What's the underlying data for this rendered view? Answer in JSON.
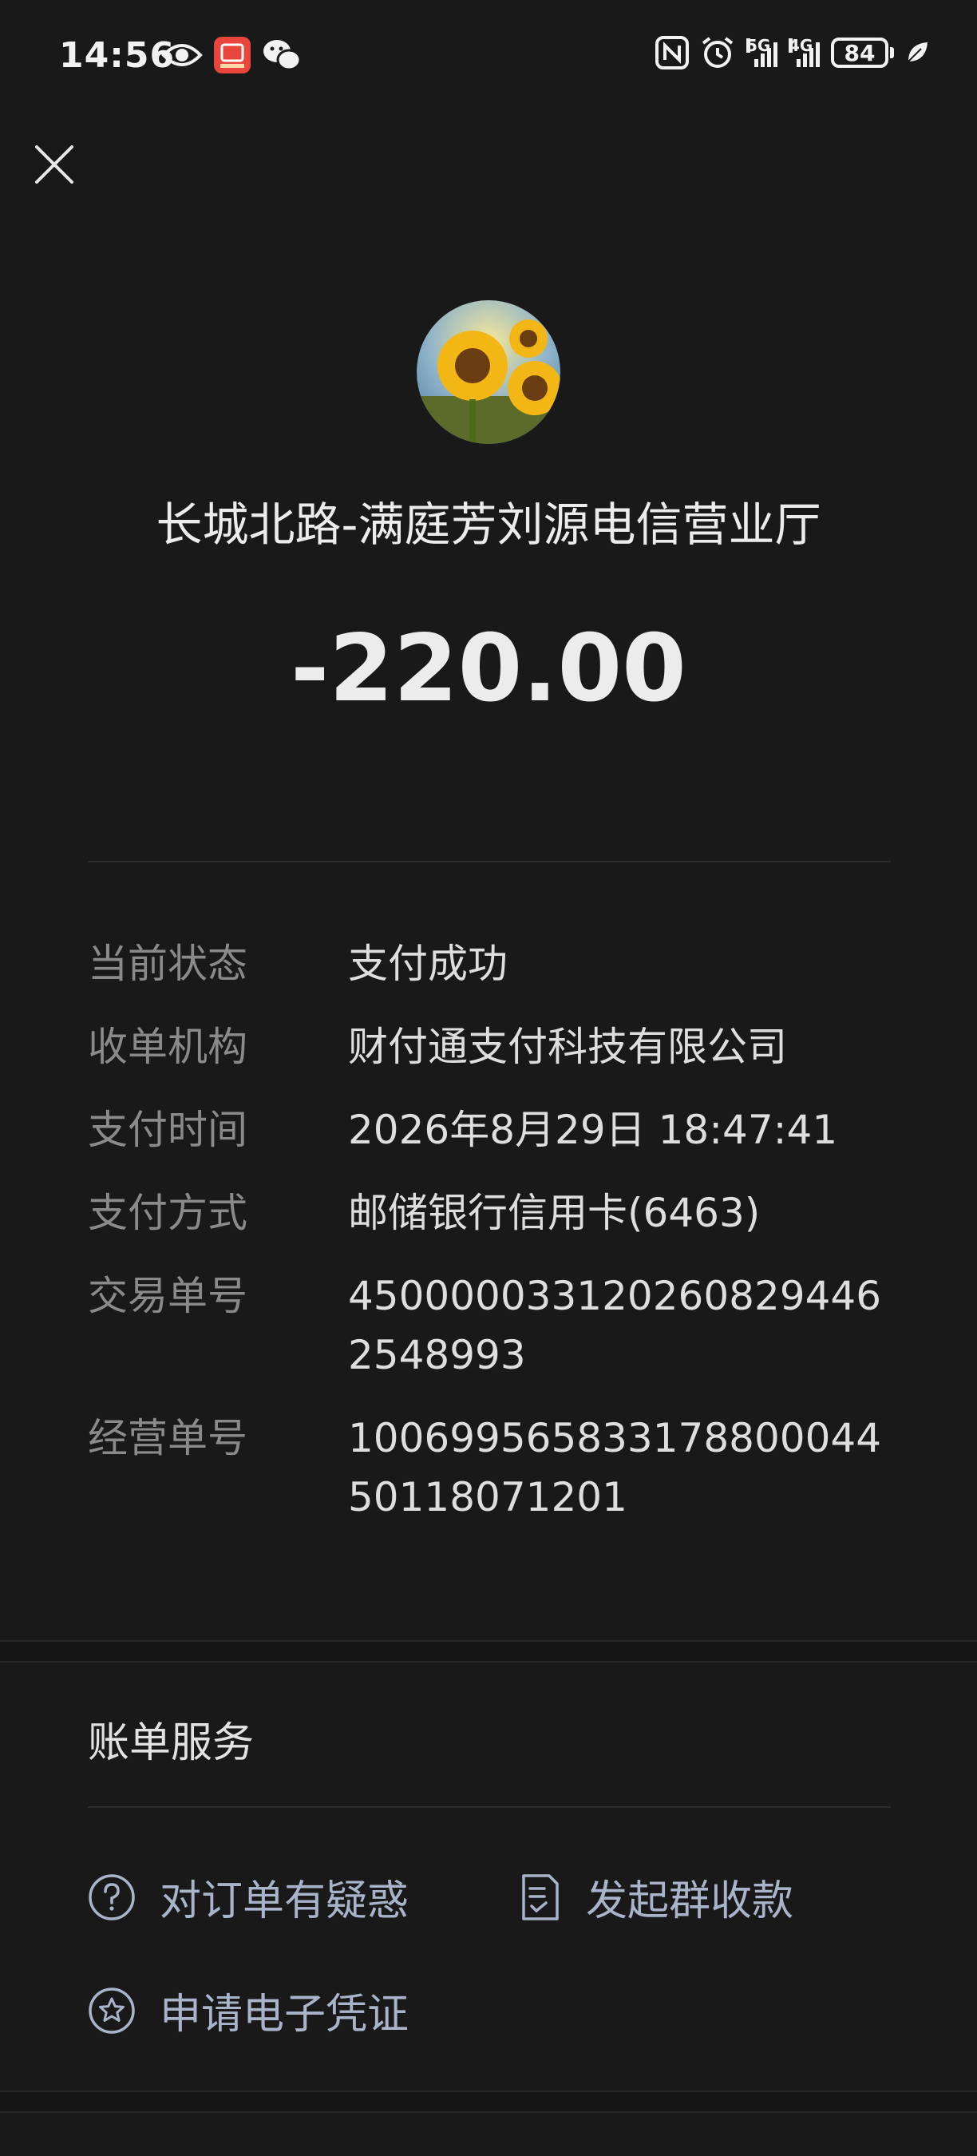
{
  "status_bar": {
    "time": "14:56",
    "left_icons": [
      "eye-icon",
      "red-app-icon",
      "wechat-icon"
    ],
    "right_icons": [
      "nfc-icon",
      "alarm-icon",
      "signal-5g-icon",
      "signal-4g-icon",
      "battery-icon",
      "leaf-icon"
    ],
    "signal_5g_label": "5G",
    "signal_4g_label": "4G",
    "battery_level": "84"
  },
  "header": {
    "close_icon": "close-icon"
  },
  "merchant": {
    "avatar": "sunflower-avatar",
    "name": "长城北路-满庭芳刘源电信营业厅"
  },
  "amount": "-220.00",
  "details": [
    {
      "label": "当前状态",
      "value": "支付成功"
    },
    {
      "label": "收单机构",
      "value": "财付通支付科技有限公司"
    },
    {
      "label": "支付时间",
      "value": "2026年8月29日 18:47:41"
    },
    {
      "label": "支付方式",
      "value": "邮储银行信用卡(6463)"
    },
    {
      "label": "交易单号",
      "value": "4500000331202608294462548993"
    },
    {
      "label": "经营单号",
      "value": "100699565833178800044501180712​01"
    }
  ],
  "bill_service": {
    "title": "账单服务",
    "actions": [
      {
        "label": "对订单有疑惑",
        "icon": "question-circle-icon"
      },
      {
        "label": "发起群收款",
        "icon": "receipt-icon"
      },
      {
        "label": "申请电子凭证",
        "icon": "star-badge-icon"
      }
    ]
  },
  "colors": {
    "background": "#191919",
    "label_gray": "#8a8a8a",
    "action_blue_gray": "#a9b4cb"
  }
}
